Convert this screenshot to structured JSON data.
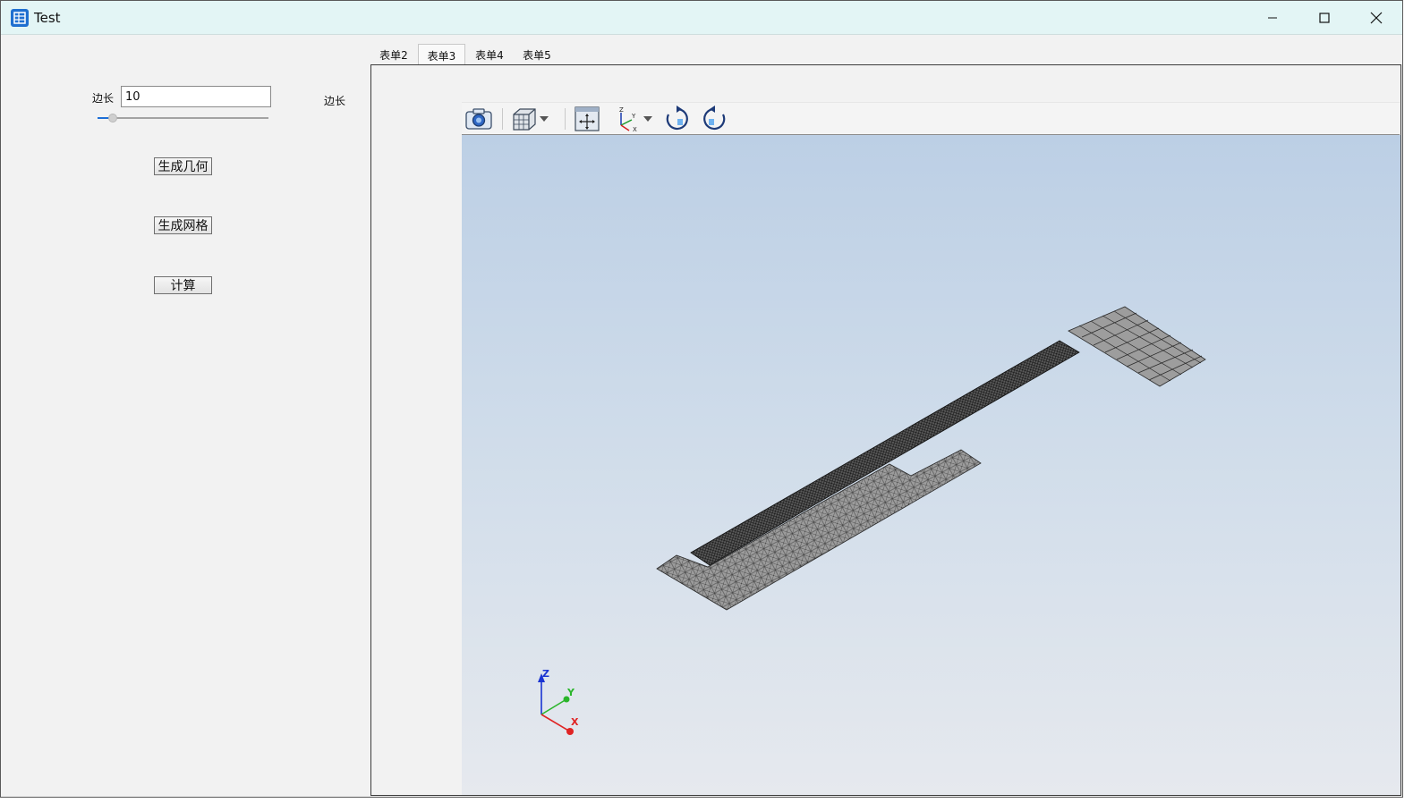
{
  "window": {
    "title": "Test",
    "minimize_label": "minimize",
    "maximize_label": "maximize",
    "close_label": "close"
  },
  "left_panel": {
    "edge_label": "边长",
    "edge_value": "10",
    "slider_fraction": 0.09,
    "right_label": "边长",
    "buttons": {
      "generate_geometry": "生成几何",
      "generate_mesh": "生成网格",
      "compute": "计算"
    }
  },
  "tabs": [
    {
      "label": "表单2",
      "active": false
    },
    {
      "label": "表单3",
      "active": true
    },
    {
      "label": "表单4",
      "active": false
    },
    {
      "label": "表单5",
      "active": false
    }
  ],
  "toolbar": {
    "icons": [
      "camera-icon",
      "view-cube-icon",
      "fit-all-icon",
      "axes-triad-icon",
      "rotate-cw-icon",
      "rotate-ccw-icon"
    ]
  },
  "axes": {
    "x": "X",
    "y": "Y",
    "z": "Z"
  },
  "colors": {
    "accent": "#1e6fd6",
    "viewport_top": "#bccfe5",
    "viewport_bottom": "#e6e9ee",
    "mesh_fill": "#9a9a9a"
  }
}
